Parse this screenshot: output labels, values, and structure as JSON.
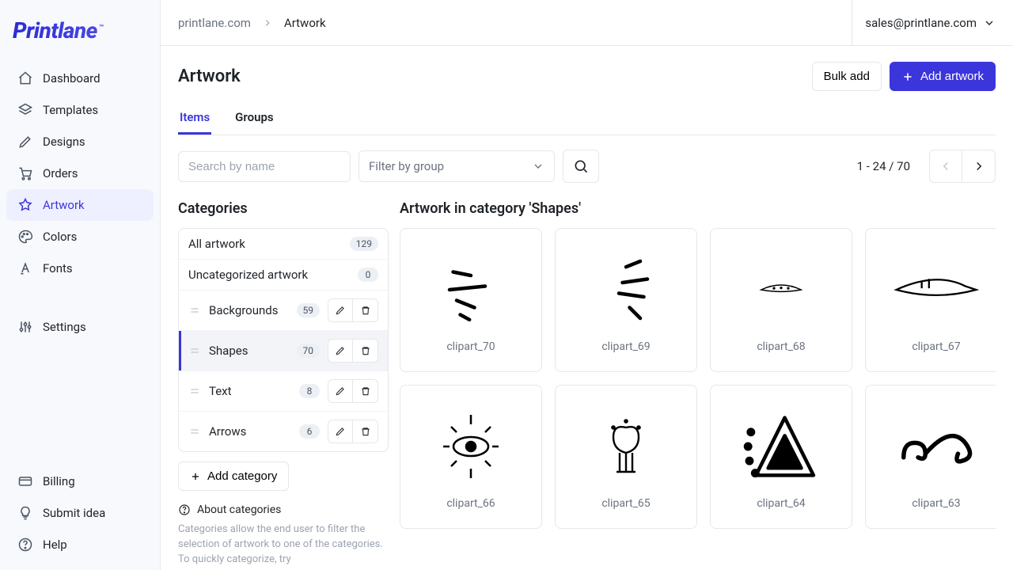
{
  "logo": {
    "text": "Printlane",
    "tm": "™"
  },
  "sidebar": {
    "items": [
      {
        "label": "Dashboard"
      },
      {
        "label": "Templates"
      },
      {
        "label": "Designs"
      },
      {
        "label": "Orders"
      },
      {
        "label": "Artwork"
      },
      {
        "label": "Colors"
      },
      {
        "label": "Fonts"
      }
    ],
    "settings_label": "Settings",
    "billing_label": "Billing",
    "submit_idea_label": "Submit idea",
    "help_label": "Help"
  },
  "breadcrumb": {
    "root": "printlane.com",
    "current": "Artwork"
  },
  "user": {
    "email": "sales@printlane.com"
  },
  "page": {
    "title": "Artwork",
    "bulk_add_label": "Bulk add",
    "add_artwork_label": "Add artwork"
  },
  "tabs": {
    "items_label": "Items",
    "groups_label": "Groups"
  },
  "filters": {
    "search_placeholder": "Search by name",
    "group_placeholder": "Filter by group",
    "range": "1 - 24 / 70"
  },
  "categories": {
    "heading": "Categories",
    "all_label": "All artwork",
    "all_count": "129",
    "uncat_label": "Uncategorized artwork",
    "uncat_count": "0",
    "items": [
      {
        "label": "Backgrounds",
        "count": "59"
      },
      {
        "label": "Shapes",
        "count": "70"
      },
      {
        "label": "Text",
        "count": "8"
      },
      {
        "label": "Arrows",
        "count": "6"
      }
    ],
    "add_label": "Add category",
    "about_title": "About categories",
    "about_body": "Categories allow the end user to filter the selection of artwork to one of the categories. To quickly categorize, try"
  },
  "grid": {
    "heading": "Artwork in category 'Shapes'",
    "items": [
      {
        "cap": "clipart_70"
      },
      {
        "cap": "clipart_69"
      },
      {
        "cap": "clipart_68"
      },
      {
        "cap": "clipart_67"
      },
      {
        "cap": "clipart_66"
      },
      {
        "cap": "clipart_65"
      },
      {
        "cap": "clipart_64"
      },
      {
        "cap": "clipart_63"
      }
    ]
  }
}
